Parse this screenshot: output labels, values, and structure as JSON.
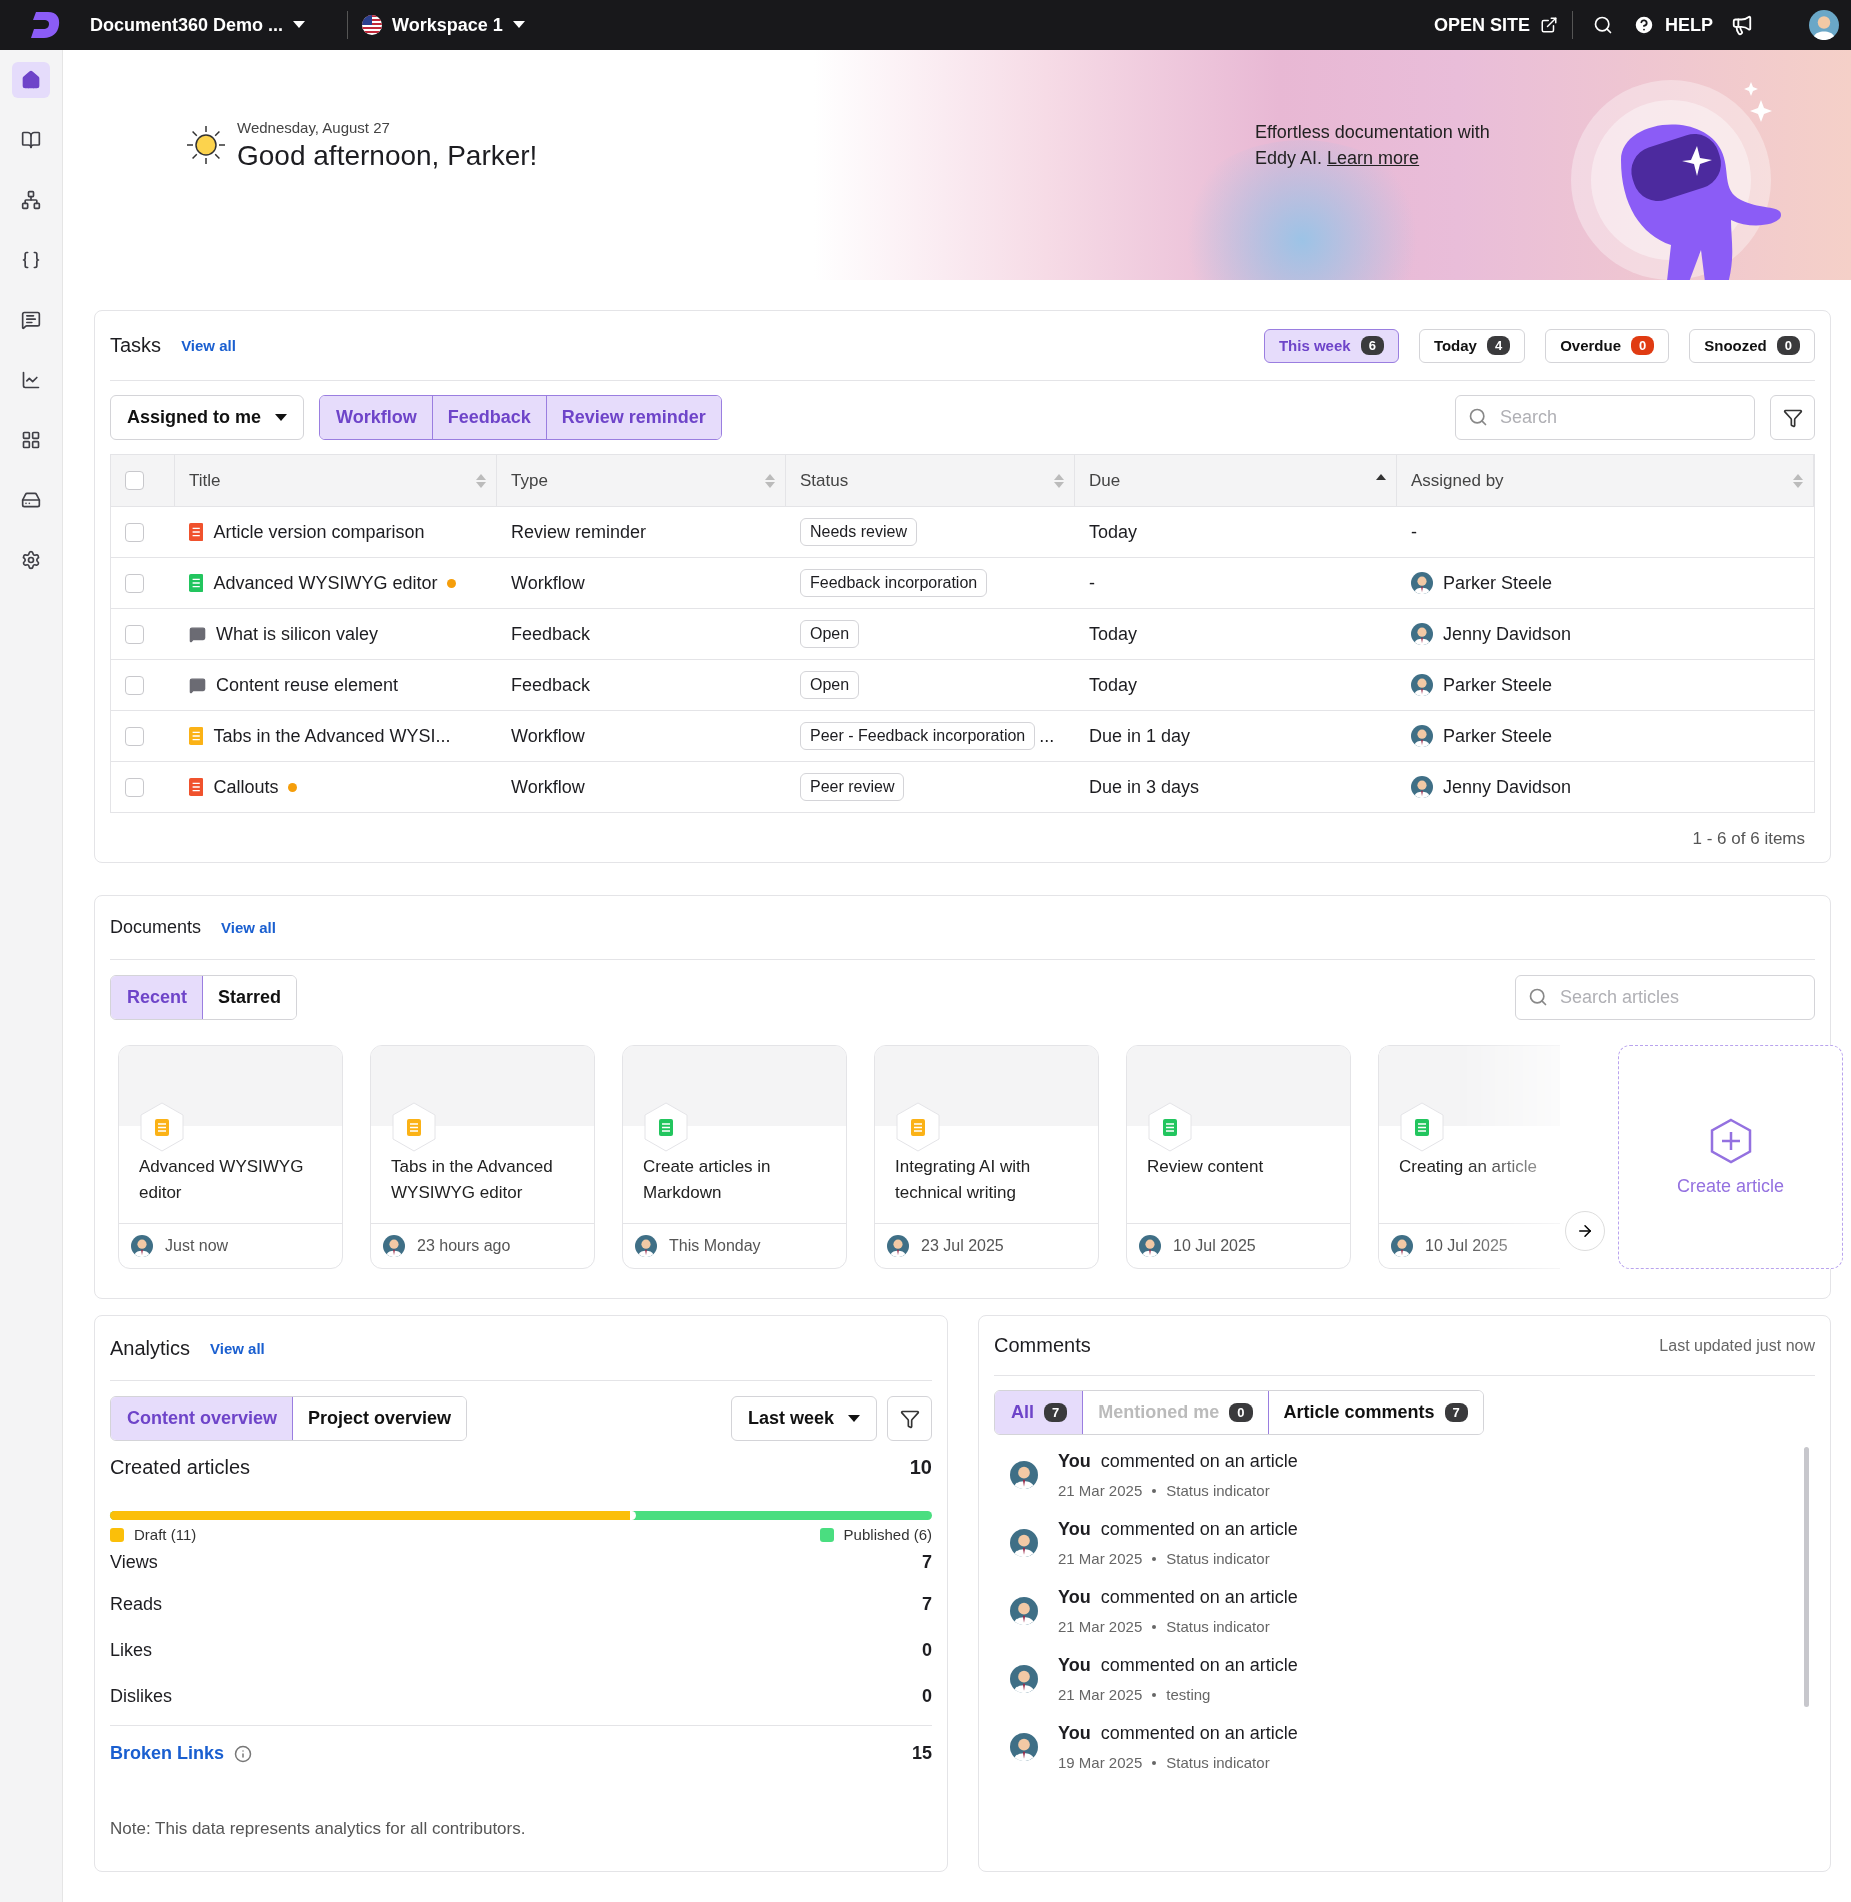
{
  "topbar": {
    "project": "Document360 Demo ...",
    "workspace": "Workspace 1",
    "open_site": "OPEN SITE",
    "help": "HELP"
  },
  "sidebar": {
    "items": [
      {
        "kind": "home",
        "selected": true
      },
      {
        "kind": "book",
        "selected": false
      },
      {
        "kind": "tree",
        "selected": false
      },
      {
        "kind": "code",
        "selected": false
      },
      {
        "kind": "comment",
        "selected": false
      },
      {
        "kind": "chart",
        "selected": false
      },
      {
        "kind": "apps",
        "selected": false
      },
      {
        "kind": "drive",
        "selected": false
      },
      {
        "kind": "settings",
        "selected": false
      }
    ]
  },
  "hero": {
    "date": "Wednesday, August 27",
    "greeting": "Good afternoon, Parker!",
    "promo": "Effortless documentation with Eddy AI.",
    "promo_link": "Learn more"
  },
  "tasks": {
    "title": "Tasks",
    "view_all": "View all",
    "periods": [
      {
        "label": "This week",
        "count": "6",
        "selected": true,
        "color": "#3a3a3c"
      },
      {
        "label": "Today",
        "count": "4",
        "selected": false,
        "color": "#3a3a3c"
      },
      {
        "label": "Overdue",
        "count": "0",
        "selected": false,
        "color": "#e03b12"
      },
      {
        "label": "Snoozed",
        "count": "0",
        "selected": false,
        "color": "#3a3a3c"
      }
    ],
    "assigned_filter": "Assigned to me",
    "type_filters": [
      {
        "label": "Workflow",
        "selected": true
      },
      {
        "label": "Feedback",
        "selected": true
      },
      {
        "label": "Review reminder",
        "selected": true
      }
    ],
    "search_placeholder": "Search",
    "select_all_checked": false,
    "columns": [
      {
        "label": "Title",
        "sorted": false
      },
      {
        "label": "Type",
        "sorted": false
      },
      {
        "label": "Status",
        "sorted": false
      },
      {
        "label": "Due",
        "sorted": true
      },
      {
        "label": "Assigned by",
        "sorted": false
      }
    ],
    "rows": [
      {
        "kind": "article",
        "color": "#f0522d",
        "title": "Article version comparison",
        "flagged": false,
        "type": "Review reminder",
        "status": "Needs review",
        "due": "Today",
        "assigned_by": "-",
        "checked": false
      },
      {
        "kind": "article",
        "color": "#22c55e",
        "title": "Advanced WYSIWYG editor",
        "flagged": true,
        "type": "Workflow",
        "status": "Feedback incorporation",
        "due": "-",
        "assigned_by": "Parker Steele",
        "checked": false
      },
      {
        "kind": "feedback",
        "color": "#6b6b73",
        "title": "What is silicon valey",
        "flagged": false,
        "type": "Feedback",
        "status": "Open",
        "due": "Today",
        "assigned_by": "Jenny Davidson",
        "checked": false
      },
      {
        "kind": "feedback",
        "color": "#6b6b73",
        "title": "Content reuse element",
        "flagged": false,
        "type": "Feedback",
        "status": "Open",
        "due": "Today",
        "assigned_by": "Parker Steele",
        "checked": false
      },
      {
        "kind": "article",
        "color": "#fbb216",
        "title": "Tabs in the Advanced WYSI...",
        "flagged": false,
        "type": "Workflow",
        "status": "Peer - Feedback incorporation",
        "status_more": "...",
        "due": "Due in 1 day",
        "assigned_by": "Parker Steele",
        "checked": false
      },
      {
        "kind": "article",
        "color": "#f0522d",
        "title": "Callouts",
        "flagged": true,
        "type": "Workflow",
        "status": "Peer review",
        "due": "Due in 3 days",
        "assigned_by": "Jenny Davidson",
        "checked": false
      }
    ],
    "footer": "1 - 6 of 6 items"
  },
  "documents": {
    "title": "Documents",
    "view_all": "View all",
    "tabs": [
      {
        "label": "Recent",
        "selected": true
      },
      {
        "label": "Starred",
        "selected": false
      }
    ],
    "search_placeholder": "Search articles",
    "cards": [
      {
        "title": "Advanced WYSIWYG editor",
        "color": "#fbb216",
        "time": "Just now",
        "faded": false
      },
      {
        "title": "Tabs in the Advanced WYSIWYG editor",
        "color": "#fbb216",
        "time": "23 hours ago",
        "faded": false
      },
      {
        "title": "Create articles in Markdown",
        "color": "#22c55e",
        "time": "This Monday",
        "faded": false
      },
      {
        "title": "Integrating AI with technical writing",
        "color": "#fbb216",
        "time": "23 Jul 2025",
        "faded": false
      },
      {
        "title": "Review content",
        "color": "#22c55e",
        "time": "10 Jul 2025",
        "faded": false
      },
      {
        "title": "Creating an article",
        "color": "#22c55e",
        "time": "10 Jul 2025",
        "faded": true
      }
    ],
    "create_label": "Create article"
  },
  "analytics": {
    "title": "Analytics",
    "view_all": "View all",
    "tabs": [
      {
        "label": "Content overview",
        "selected": true
      },
      {
        "label": "Project overview",
        "selected": false
      }
    ],
    "period": "Last week",
    "created_label": "Created articles",
    "created_total": "10",
    "bar": {
      "level": 0.64
    },
    "segments": [
      {
        "label": "Draft (11)",
        "color": "#fbbf09"
      },
      {
        "label": "Published (6)",
        "color": "#4ade80"
      }
    ],
    "metrics": [
      {
        "label": "Views",
        "value": "7"
      },
      {
        "label": "Reads",
        "value": "7"
      },
      {
        "label": "Likes",
        "value": "0"
      },
      {
        "label": "Dislikes",
        "value": "0"
      }
    ],
    "broken_links": {
      "label": "Broken Links",
      "value": "15"
    },
    "note": "Note: This data represents analytics for all contributors."
  },
  "comments": {
    "title": "Comments",
    "updated": "Last updated just now",
    "tabs": [
      {
        "label": "All",
        "count": "7",
        "selected": true,
        "disabled": false
      },
      {
        "label": "Mentioned me",
        "count": "0",
        "selected": false,
        "disabled": true
      },
      {
        "label": "Article comments",
        "count": "7",
        "selected": false,
        "disabled": false
      }
    ],
    "items": [
      {
        "author": "You",
        "text": "commented on an article",
        "date": "21 Mar 2025",
        "tag": "Status indicator"
      },
      {
        "author": "You",
        "text": "commented on an article",
        "date": "21 Mar 2025",
        "tag": "Status indicator"
      },
      {
        "author": "You",
        "text": "commented on an article",
        "date": "21 Mar 2025",
        "tag": "Status indicator"
      },
      {
        "author": "You",
        "text": "commented on an article",
        "date": "21 Mar 2025",
        "tag": "testing"
      },
      {
        "author": "You",
        "text": "commented on an article",
        "date": "19 Mar 2025",
        "tag": "Status indicator"
      }
    ]
  }
}
